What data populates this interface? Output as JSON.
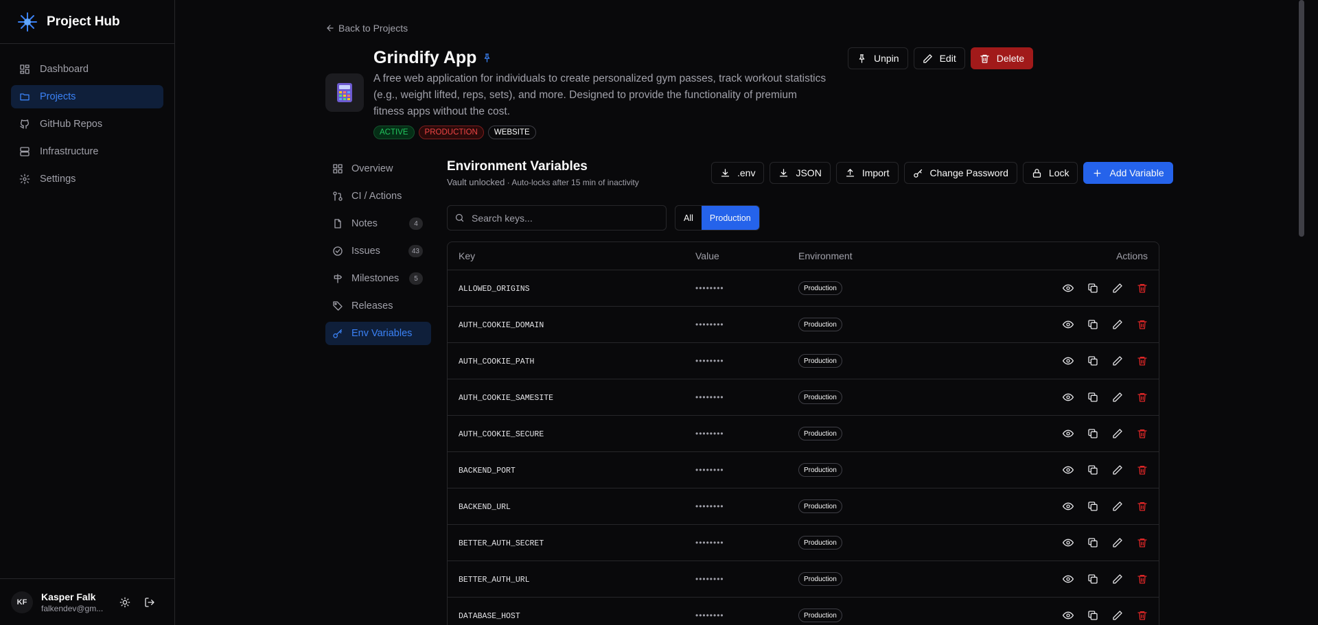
{
  "app": {
    "title": "Project Hub"
  },
  "sidebar": {
    "items": [
      {
        "label": "Dashboard",
        "icon": "dashboard-icon"
      },
      {
        "label": "Projects",
        "icon": "folder-icon",
        "active": true
      },
      {
        "label": "GitHub Repos",
        "icon": "github-icon"
      },
      {
        "label": "Infrastructure",
        "icon": "server-icon"
      },
      {
        "label": "Settings",
        "icon": "gear-icon"
      }
    ]
  },
  "user": {
    "initials": "KF",
    "name": "Kasper Falk",
    "email": "falkendev@gm..."
  },
  "back_label": "Back to Projects",
  "project": {
    "name": "Grindify App",
    "description": "A free web application for individuals to create personalized gym passes, track workout statistics (e.g., weight lifted, reps, sets), and more. Designed to provide the functionality of premium fitness apps without the cost.",
    "tags": [
      "ACTIVE",
      "PRODUCTION",
      "WEBSITE"
    ]
  },
  "top_actions": {
    "unpin": "Unpin",
    "edit": "Edit",
    "delete": "Delete"
  },
  "subnav": {
    "overview": "Overview",
    "ci": "CI / Actions",
    "notes": "Notes",
    "notes_count": "4",
    "issues": "Issues",
    "issues_count": "43",
    "milestones": "Milestones",
    "milestones_count": "5",
    "releases": "Releases",
    "env": "Env Variables"
  },
  "env": {
    "title": "Environment Variables",
    "status": "Vault unlocked",
    "status_note": " · Auto-locks after 15 min of inactivity",
    "actions": {
      "env": ".env",
      "json": "JSON",
      "import": "Import",
      "change_password": "Change Password",
      "lock": "Lock",
      "add": "Add Variable"
    },
    "search_placeholder": "Search keys...",
    "filters": {
      "all": "All",
      "production": "Production"
    },
    "columns": {
      "key": "Key",
      "value": "Value",
      "environment": "Environment",
      "actions": "Actions"
    },
    "rows": [
      {
        "key": "ALLOWED_ORIGINS",
        "value": "••••••••",
        "env": "Production"
      },
      {
        "key": "AUTH_COOKIE_DOMAIN",
        "value": "••••••••",
        "env": "Production"
      },
      {
        "key": "AUTH_COOKIE_PATH",
        "value": "••••••••",
        "env": "Production"
      },
      {
        "key": "AUTH_COOKIE_SAMESITE",
        "value": "••••••••",
        "env": "Production"
      },
      {
        "key": "AUTH_COOKIE_SECURE",
        "value": "••••••••",
        "env": "Production"
      },
      {
        "key": "BACKEND_PORT",
        "value": "••••••••",
        "env": "Production"
      },
      {
        "key": "BACKEND_URL",
        "value": "••••••••",
        "env": "Production"
      },
      {
        "key": "BETTER_AUTH_SECRET",
        "value": "••••••••",
        "env": "Production"
      },
      {
        "key": "BETTER_AUTH_URL",
        "value": "••••••••",
        "env": "Production"
      },
      {
        "key": "DATABASE_HOST",
        "value": "••••••••",
        "env": "Production"
      }
    ]
  },
  "colors": {
    "accent": "#2563eb",
    "danger": "#a11a1a",
    "success": "#22c55e",
    "background": "#09090b"
  }
}
